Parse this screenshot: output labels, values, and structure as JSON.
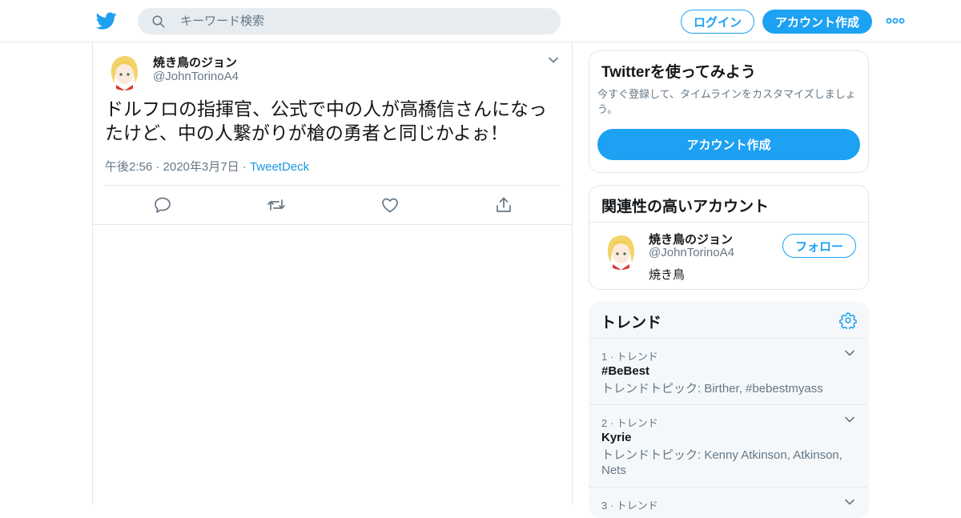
{
  "header": {
    "search_placeholder": "キーワード検索",
    "login_label": "ログイン",
    "signup_label": "アカウント作成",
    "brand_color": "#1da1f2"
  },
  "tweet": {
    "author_name": "焼き鳥のジョン",
    "author_handle": "@JohnTorinoA4",
    "text_line1": "ドルフロの指揮官、公式で中の人が高橋信さんになっ",
    "text_line2": "たけど、中の人繋がりが槍の勇者と同じかよぉ！",
    "timestamp": "午後2:56 · 2020年3月7日",
    "separator": " · ",
    "source": "TweetDeck",
    "actions": [
      "reply-icon",
      "retweet-icon",
      "like-icon",
      "share-icon"
    ]
  },
  "signup_card": {
    "title": "Twitterを使ってみよう",
    "description": "今すぐ登録して、タイムラインをカスタマイズしましょう。",
    "button": "アカウント作成"
  },
  "related": {
    "title": "関連性の高いアカウント",
    "name": "焼き鳥のジョン",
    "handle": "@JohnTorinoA4",
    "bio": "焼き鳥",
    "follow_label": "フォロー"
  },
  "trends": {
    "title": "トレンド",
    "items": [
      {
        "rank": "1 · トレンド",
        "tag": "#BeBest",
        "topics": "トレンドトピック: Birther, #bebestmyass"
      },
      {
        "rank": "2 · トレンド",
        "tag": "Kyrie",
        "topics": "トレンドトピック: Kenny Atkinson, Atkinson, Nets"
      },
      {
        "rank": "3 · トレンド",
        "tag": "",
        "topics": ""
      }
    ]
  }
}
